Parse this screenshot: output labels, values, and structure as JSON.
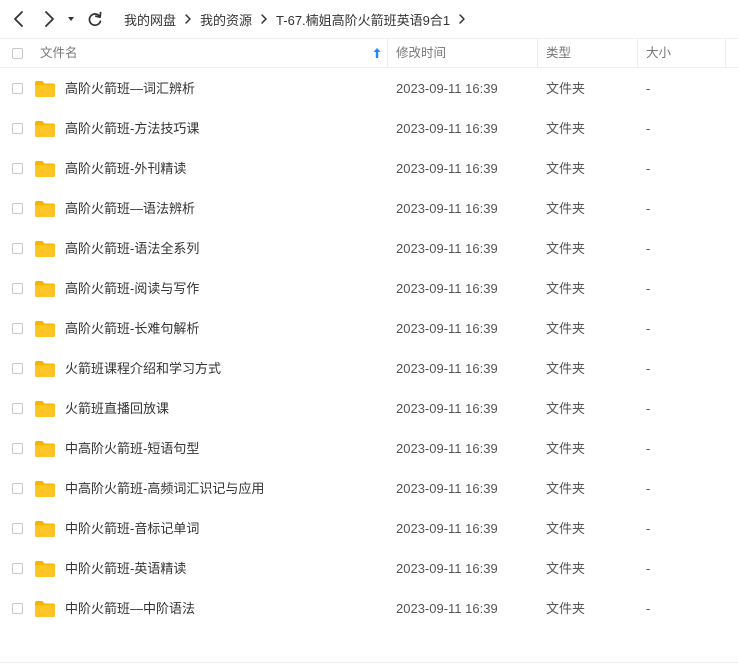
{
  "toolbar": {
    "back_icon": "chevron-left-icon",
    "forward_icon": "chevron-right-icon",
    "history_icon": "caret-down-icon",
    "refresh_icon": "refresh-icon"
  },
  "breadcrumb": [
    "我的网盘",
    "我的资源",
    "T-67.楠姐高阶火箭班英语9合1"
  ],
  "columns": {
    "name": "文件名",
    "modified": "修改时间",
    "type": "类型",
    "size": "大小"
  },
  "sort": {
    "column": "name",
    "direction": "ascending",
    "icon": "sort-up-arrow-icon"
  },
  "accent_color": "#1a8cff",
  "folder_color": "#ffc425",
  "files": [
    {
      "name": "高阶火箭班—词汇辨析",
      "modified": "2023-09-11 16:39",
      "type": "文件夹",
      "size": "-"
    },
    {
      "name": "高阶火箭班-方法技巧课",
      "modified": "2023-09-11 16:39",
      "type": "文件夹",
      "size": "-"
    },
    {
      "name": "高阶火箭班-外刊精读",
      "modified": "2023-09-11 16:39",
      "type": "文件夹",
      "size": "-"
    },
    {
      "name": "高阶火箭班—语法辨析",
      "modified": "2023-09-11 16:39",
      "type": "文件夹",
      "size": "-"
    },
    {
      "name": "高阶火箭班-语法全系列",
      "modified": "2023-09-11 16:39",
      "type": "文件夹",
      "size": "-"
    },
    {
      "name": "高阶火箭班-阅读与写作",
      "modified": "2023-09-11 16:39",
      "type": "文件夹",
      "size": "-"
    },
    {
      "name": "高阶火箭班-长难句解析",
      "modified": "2023-09-11 16:39",
      "type": "文件夹",
      "size": "-"
    },
    {
      "name": "火箭班课程介绍和学习方式",
      "modified": "2023-09-11 16:39",
      "type": "文件夹",
      "size": "-"
    },
    {
      "name": "火箭班直播回放课",
      "modified": "2023-09-11 16:39",
      "type": "文件夹",
      "size": "-"
    },
    {
      "name": "中高阶火箭班-短语句型",
      "modified": "2023-09-11 16:39",
      "type": "文件夹",
      "size": "-"
    },
    {
      "name": "中高阶火箭班-高频词汇识记与应用",
      "modified": "2023-09-11 16:39",
      "type": "文件夹",
      "size": "-"
    },
    {
      "name": "中阶火箭班-音标记单词",
      "modified": "2023-09-11 16:39",
      "type": "文件夹",
      "size": "-"
    },
    {
      "name": "中阶火箭班-英语精读",
      "modified": "2023-09-11 16:39",
      "type": "文件夹",
      "size": "-"
    },
    {
      "name": "中阶火箭班—中阶语法",
      "modified": "2023-09-11 16:39",
      "type": "文件夹",
      "size": "-"
    }
  ]
}
